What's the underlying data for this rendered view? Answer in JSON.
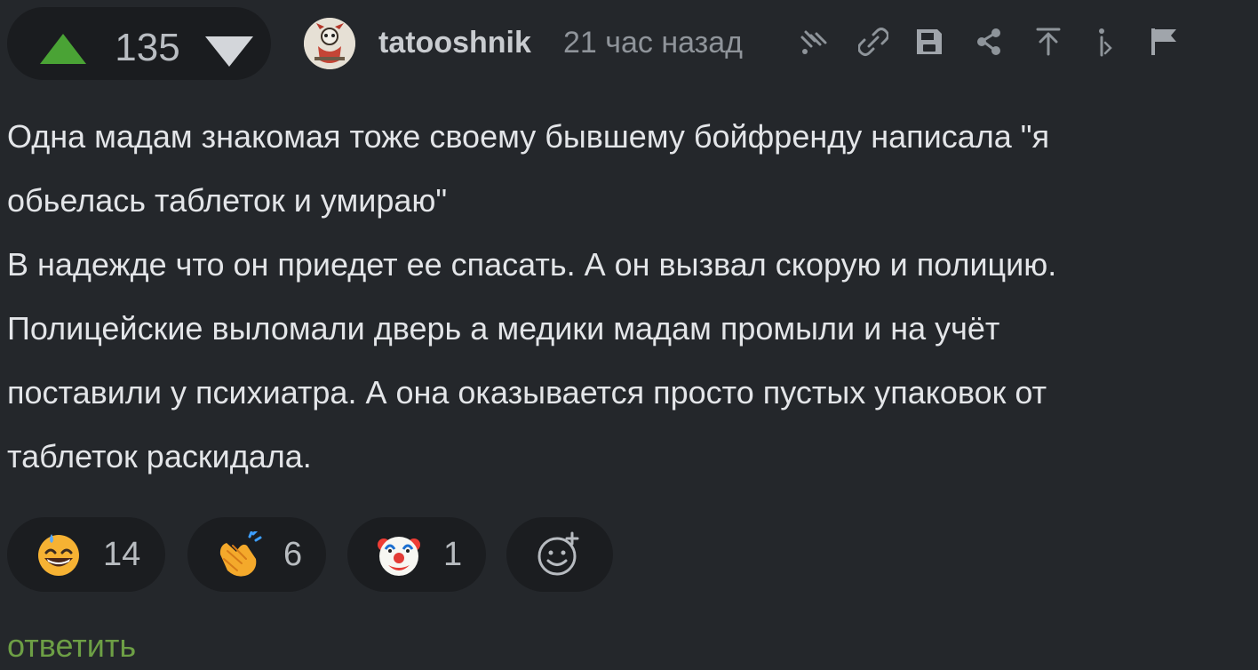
{
  "comment": {
    "rating": "135",
    "author": "tatooshnik",
    "time": "21 час назад",
    "body": [
      "Одна мадам знакомая тоже своему бывшему бойфренду написала \"я",
      "обьелась таблеток и умираю\"",
      "В надежде что он приедет ее спасать. А он вызвал скорую и полицию.",
      "Полицейские выломали дверь а медики мадам промыли и на учёт",
      "поставили у психиатра. А она оказывается просто пустых упаковок от",
      "таблеток раскидала."
    ]
  },
  "reactions": [
    {
      "emoji": "grinning-sweat-face",
      "count": "14"
    },
    {
      "emoji": "clapping-hands",
      "count": "6"
    },
    {
      "emoji": "clown-face",
      "count": "1"
    }
  ],
  "actions": {
    "reply": "ответить"
  },
  "icons": {
    "upvote": "triangle-up-icon",
    "downvote": "triangle-down-icon",
    "branch": "thread-branch-icon",
    "link": "link-icon",
    "save": "save-icon",
    "share": "share-icon",
    "jump_to_parent": "arrow-up-icon",
    "collapse": "collapse-icon",
    "report": "flag-icon",
    "add_reaction": "add-reaction-icon"
  },
  "colors": {
    "background": "#24272b",
    "upvote": "#4aa335",
    "downvote": "#d3d6da",
    "reply": "#6d9f45"
  }
}
